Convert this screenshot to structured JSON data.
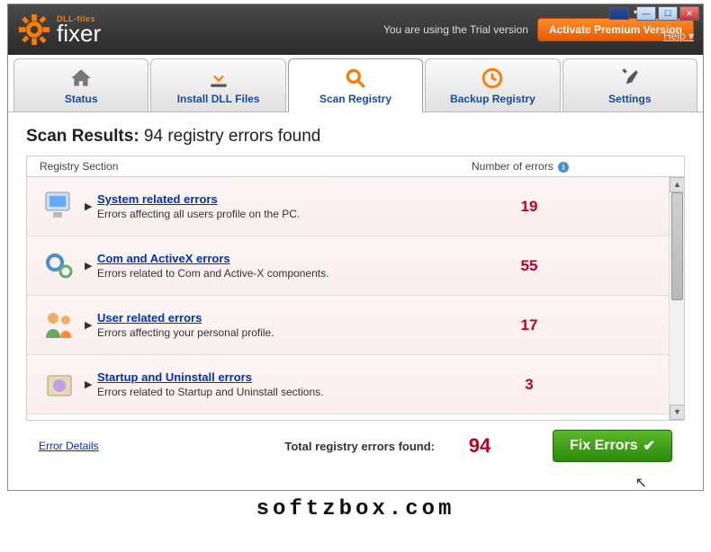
{
  "brand": {
    "small": "DLL-files",
    "big": "fixer"
  },
  "trial": "You are using the Trial version",
  "activate": "Activate Premium Version",
  "help": "Help ▾",
  "tabs": [
    {
      "label": "Status"
    },
    {
      "label": "Install DLL Files"
    },
    {
      "label": "Scan Registry"
    },
    {
      "label": "Backup Registry"
    },
    {
      "label": "Settings"
    }
  ],
  "heading_bold": "Scan Results:",
  "heading_rest": " 94 registry errors found",
  "th1": "Registry Section",
  "th2": "Number of errors",
  "rows": [
    {
      "title": "System related errors",
      "desc": "Errors affecting all users profile on the PC.",
      "count": "19"
    },
    {
      "title": "Com and ActiveX errors",
      "desc": "Errors related to Com and Active-X components.",
      "count": "55"
    },
    {
      "title": "User related errors",
      "desc": "Errors affecting your personal profile.",
      "count": "17"
    },
    {
      "title": "Startup and Uninstall errors",
      "desc": "Errors related to Startup and Uninstall sections.",
      "count": "3"
    }
  ],
  "error_details": "Error Details",
  "total_label": "Total registry errors found:",
  "total_value": "94",
  "fix": "Fix Errors",
  "watermark": "softzbox.com"
}
